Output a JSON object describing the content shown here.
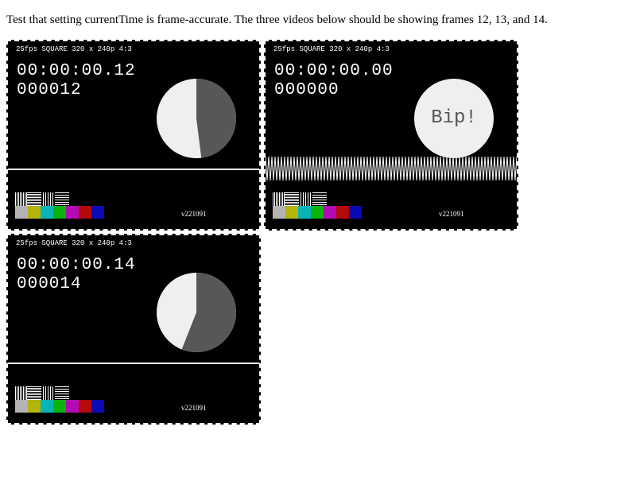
{
  "caption": "Test that setting currentTime is frame-accurate. The three videos below should be showing frames 12, 13, and 14.",
  "colors": {
    "page_background": "#ffffff",
    "video_background": "#000000",
    "pie_light": "#efefef",
    "pie_dark": "#575757",
    "bip_text": "#555555"
  },
  "color_bars": [
    "#b4b4b4",
    "#b4b40a",
    "#0ab4b4",
    "#0ab40a",
    "#b40ab4",
    "#b40a0a",
    "#0a0ab4"
  ],
  "videos": [
    {
      "name": "video-frame-12",
      "meta": "25fps SQUARE 320 x 240p 4:3",
      "timecode": "00:00:00.12",
      "framecount": "000012",
      "version": "v221091",
      "visual": "pie",
      "pie_dark_fraction": 0.48
    },
    {
      "name": "video-frame-13",
      "meta": "25fps SQUARE 320 x 240p 4:3",
      "timecode": "00:00:00.00",
      "framecount": "000000",
      "version": "v221091",
      "visual": "bip",
      "bip_text": "Bip!"
    },
    {
      "name": "video-frame-14",
      "meta": "25fps SQUARE 320 x 240p 4:3",
      "timecode": "00:00:00.14",
      "framecount": "000014",
      "version": "v221091",
      "visual": "pie",
      "pie_dark_fraction": 0.56
    }
  ]
}
